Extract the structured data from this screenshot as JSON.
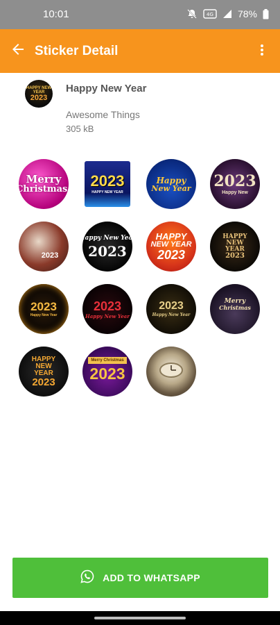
{
  "status_bar": {
    "time": "10:01",
    "battery": "78%"
  },
  "app_bar": {
    "title": "Sticker Detail"
  },
  "pack": {
    "tray_text_top": "HAPPY NEW YEAR",
    "tray_text_year": "2023",
    "name": "Happy New Year",
    "publisher": "Awesome Things",
    "size": "305 kB"
  },
  "stickers": [
    {
      "lines": [
        "Merry",
        "Christmas!"
      ]
    },
    {
      "lines": [
        "2023",
        "HAPPY NEW YEAR"
      ]
    },
    {
      "lines": [
        "Happy",
        "New Year"
      ]
    },
    {
      "lines": [
        "2023",
        "Happy New"
      ]
    },
    {
      "lines": [
        "2023"
      ]
    },
    {
      "lines": [
        "Happy New Year",
        "2023"
      ]
    },
    {
      "lines": [
        "HAPPY",
        "NEW YEAR",
        "2023"
      ]
    },
    {
      "lines": [
        "HAPPY",
        "NEW",
        "YEAR",
        "2023"
      ]
    },
    {
      "lines": [
        "2023",
        "Happy New Year"
      ]
    },
    {
      "lines": [
        "2023",
        "Happy New Year"
      ]
    },
    {
      "lines": [
        "2023",
        "Happy New Year"
      ]
    },
    {
      "lines": [
        "Merry",
        "Christmas"
      ]
    },
    {
      "lines": [
        "HAPPY",
        "NEW",
        "YEAR",
        "2023"
      ]
    },
    {
      "lines": [
        "Merry Christmas",
        "2023"
      ]
    },
    {
      "lines": []
    }
  ],
  "add_button": {
    "label": "ADD TO WHATSAPP"
  },
  "colors": {
    "app_bar": "#f7941d",
    "add_button": "#4fbf3a",
    "status_bar": "#8e8e8e"
  }
}
